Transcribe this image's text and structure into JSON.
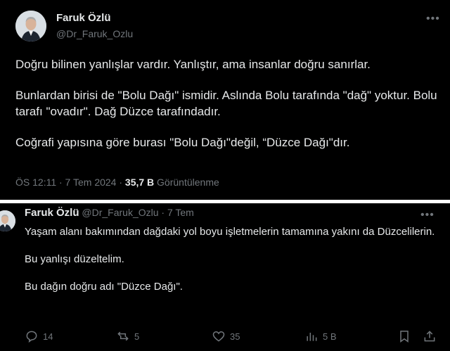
{
  "tweet1": {
    "author_name": "Faruk Özlü",
    "author_handle": "@Dr_Faruk_Ozlu",
    "more_icon": "more-icon",
    "paragraphs": [
      "Doğru bilinen yanlışlar vardır. Yanlıştır, ama insanlar doğru sanırlar.",
      "Bunlardan birisi de \"Bolu Dağı\" ismidir. Aslında Bolu tarafında \"dağ\" yoktur. Bolu tarafı \"ovadır\". Dağ Düzce tarafındadır.",
      "Coğrafi yapısına göre burası \"Bolu Dağı\"değil, “Düzce Dağı\"dır."
    ],
    "timestamp": "ÖS 12:11 · 7 Tem 2024 ·",
    "views_count": "35,7 B",
    "views_label": "Görüntülenme"
  },
  "tweet2": {
    "author_name": "Faruk Özlü",
    "author_handle": "@Dr_Faruk_Ozlu · 7 Tem",
    "more_icon": "more-icon",
    "paragraphs": [
      "Yaşam alanı bakımından dağdaki yol boyu işletmelerin tamamına yakını da Düzcelilerin.",
      "Bu yanlışı düzeltelim.",
      "Bu dağın doğru adı \"Düzce Dağı\"."
    ],
    "actions": {
      "replies": "14",
      "reposts": "5",
      "likes": "35",
      "views": "5 B"
    },
    "icons": [
      "reply-icon",
      "repost-icon",
      "like-icon",
      "views-icon",
      "bookmark-icon",
      "share-icon"
    ]
  },
  "colors": {
    "background": "#000000",
    "text": "#e7e9ea",
    "muted": "#71767b",
    "divider": "#ffffff"
  }
}
